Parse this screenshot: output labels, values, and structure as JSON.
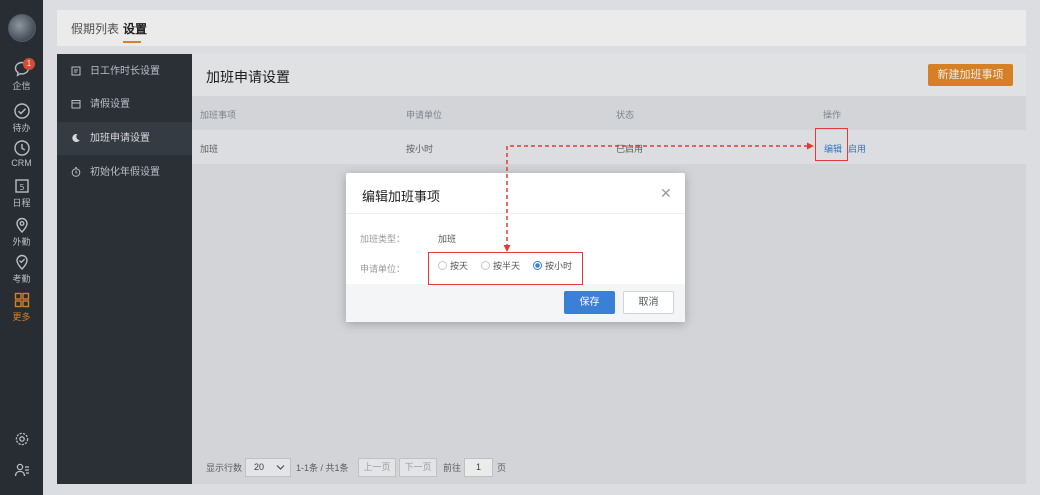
{
  "rail": {
    "items": [
      {
        "label": "企信",
        "icon": "chat-icon",
        "badge": "1"
      },
      {
        "label": "待办",
        "icon": "check-icon"
      },
      {
        "label": "CRM",
        "icon": "clock-icon"
      },
      {
        "label": "日程",
        "icon": "calendar-icon",
        "glyph": "5"
      },
      {
        "label": "外勤",
        "icon": "location-icon"
      },
      {
        "label": "考勤",
        "icon": "attendance-icon"
      },
      {
        "label": "更多",
        "icon": "grid-icon"
      }
    ],
    "accent": "#e98b2a"
  },
  "tabs": [
    "假期列表",
    "设置"
  ],
  "sidebar": {
    "items": [
      {
        "label": "日工作时长设置",
        "icon": "document-icon"
      },
      {
        "label": "请假设置",
        "icon": "calendar-icon"
      },
      {
        "label": "加班申请设置",
        "icon": "moon-icon"
      },
      {
        "label": "初始化年假设置",
        "icon": "timer-icon"
      }
    ]
  },
  "main": {
    "title": "加班申请设置",
    "new_button": "新建加班事项",
    "columns": [
      "加班事项",
      "申请单位",
      "状态",
      "操作"
    ],
    "row": {
      "item": "加班",
      "unit": "按小时",
      "status": "已启用",
      "edit": "编辑",
      "enable": "启用"
    }
  },
  "pager": {
    "rows_label": "显示行数",
    "rows_value": "20",
    "summary": "1-1条 / 共1条",
    "prev": "上一页",
    "next": "下一页",
    "goto": "前往",
    "page": "1",
    "page_unit": "页"
  },
  "dialog": {
    "title": "编辑加班事项",
    "type_label": "加班类型：",
    "type_value": "加班",
    "unit_label": "申请单位：",
    "options": [
      "按天",
      "按半天",
      "按小时"
    ],
    "selected": "按小时",
    "save": "保存",
    "cancel": "取消"
  }
}
